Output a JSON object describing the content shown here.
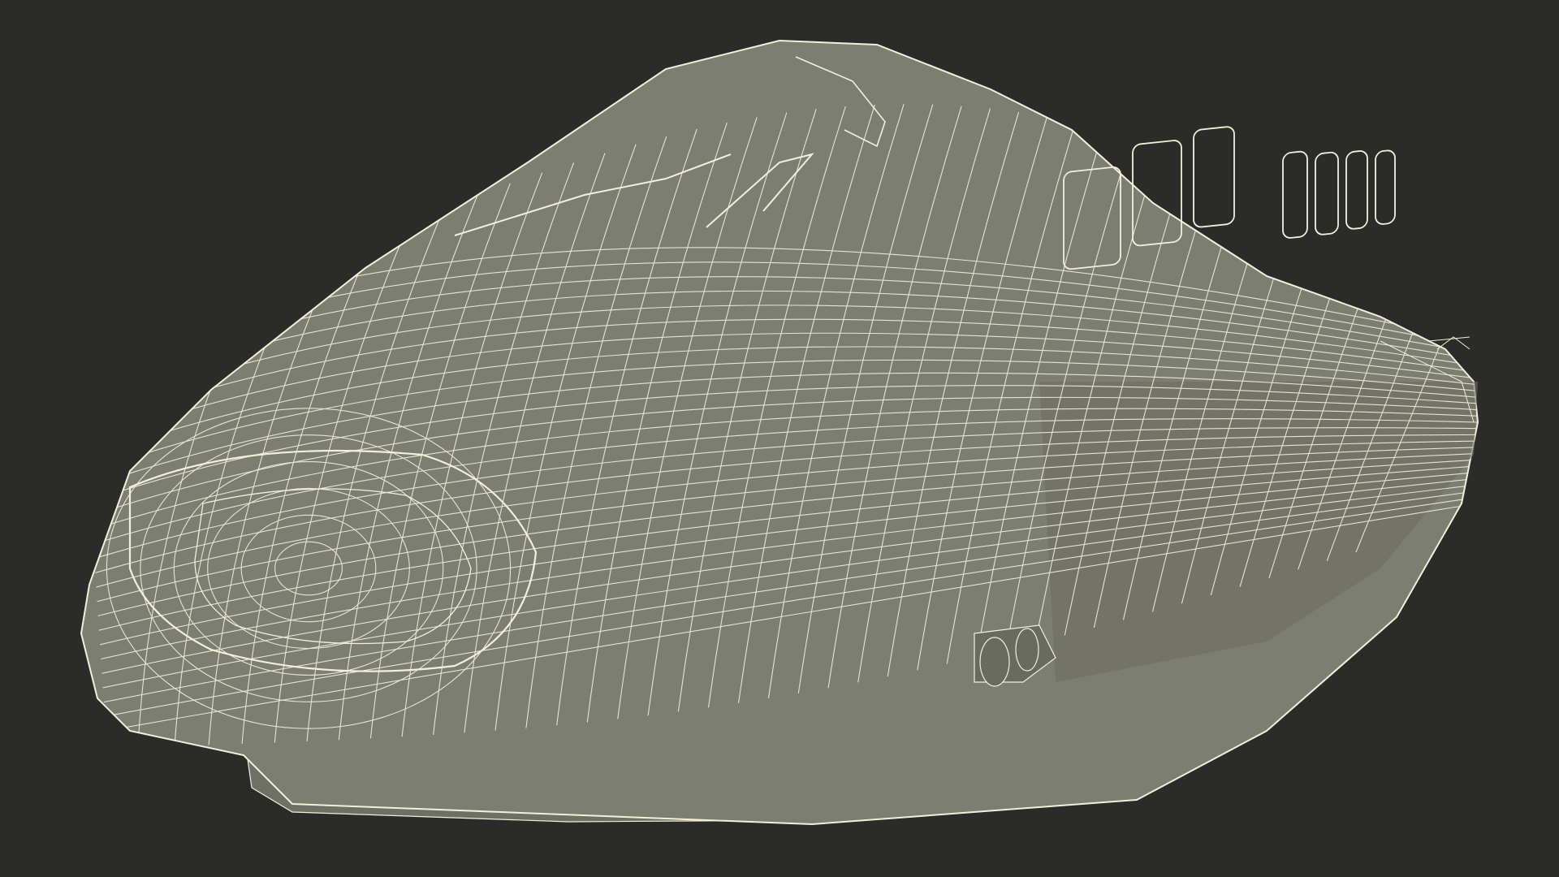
{
  "scene": {
    "subject": "wireframe-train-nose",
    "colors": {
      "background": "#2b2b29",
      "surface": "#7d7e72",
      "surface_shade": "#6c6d62",
      "surface_light": "#8a8b7f",
      "wire": "#f2f0dc",
      "wire_dim": "#d9d7c4"
    }
  }
}
